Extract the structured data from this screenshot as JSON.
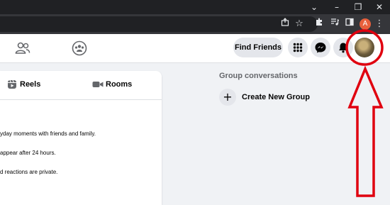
{
  "browser": {
    "window_controls": [
      "⌄",
      "–",
      "❐",
      "✕"
    ],
    "profile_letter": "A",
    "toolbar_icons": [
      "share-icon",
      "star-icon",
      "extensions-icon",
      "media-icon",
      "sidebar-icon",
      "menu-icon"
    ]
  },
  "header": {
    "find_friends_label": "Find Friends",
    "icons": [
      "friends-icon",
      "groups-icon",
      "apps-grid-icon",
      "messenger-icon",
      "notifications-icon"
    ]
  },
  "card": {
    "tabs": [
      {
        "label": "Reels",
        "icon": "reels-icon"
      },
      {
        "label": "Rooms",
        "icon": "video-camera-icon"
      }
    ],
    "lines": [
      "yday moments with friends and family.",
      "appear after 24 hours.",
      "d reactions are private."
    ]
  },
  "right_panel": {
    "title": "Group conversations",
    "create_label": "Create New Group",
    "create_icon": "+"
  },
  "colors": {
    "annotation": "#e0000f",
    "toolbar_bg": "#35363a",
    "titlebar_bg": "#202124",
    "page_bg": "#f0f2f5"
  }
}
